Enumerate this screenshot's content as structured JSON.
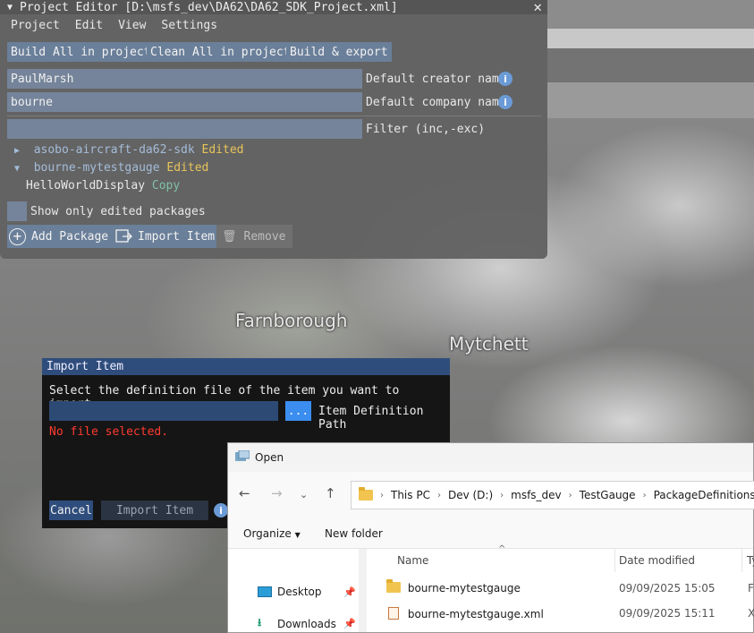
{
  "map": {
    "labels": [
      "Farnborough",
      "Mytchett"
    ]
  },
  "project_editor": {
    "title": "Project Editor [D:\\msfs_dev\\DA62\\DA62_SDK_Project.xml]",
    "menu": [
      "Project",
      "Edit",
      "View",
      "Settings"
    ],
    "buttons": {
      "build_all": "Build All in project",
      "clean_all": "Clean All in project",
      "build_export": "Build & export"
    },
    "creator": {
      "value": "PaulMarsh",
      "label": "Default creator name"
    },
    "company": {
      "value": "bourne",
      "label": "Default company name"
    },
    "filter": {
      "value": "",
      "label": "Filter (inc,-exc)"
    },
    "tree": [
      {
        "name": "asobo-aircraft-da62-sdk",
        "status": "Edited"
      },
      {
        "name": "bourne-mytestgauge",
        "status": "Edited"
      },
      {
        "name": "HelloWorldDisplay",
        "status": "Copy"
      }
    ],
    "show_edited_label": "Show only edited packages",
    "bottom_buttons": {
      "add_package": "Add Package",
      "import_item": "Import Item",
      "remove": "Remove"
    }
  },
  "import_dialog": {
    "title": "Import Item",
    "prompt": "Select the definition file of the item you want to import:",
    "path_value": "",
    "browse_label": "...",
    "path_label": "Item Definition Path",
    "error": "No file selected.",
    "cancel_label": "Cancel",
    "import_label": "Import Item"
  },
  "open_dialog": {
    "title": "Open",
    "breadcrumb": [
      "This PC",
      "Dev (D:)",
      "msfs_dev",
      "TestGauge",
      "PackageDefinitions"
    ],
    "organize_label": "Organize",
    "new_folder_label": "New folder",
    "nav_items": [
      {
        "label": "Desktop",
        "icon": "desktop-icon"
      },
      {
        "label": "Downloads",
        "icon": "download-icon"
      }
    ],
    "columns": [
      "Name",
      "Date modified",
      "Ty"
    ],
    "files": [
      {
        "name": "bourne-mytestgauge",
        "date": "09/09/2025 15:05",
        "type": "F",
        "icon": "folder-icon"
      },
      {
        "name": "bourne-mytestgauge.xml",
        "date": "09/09/2025 15:11",
        "type": "X",
        "icon": "xml-file-icon"
      }
    ]
  },
  "colors": {
    "accent_blue": "#3b8ef0",
    "edited": "#e8c45a",
    "copy": "#7fc2a6",
    "error": "#ff3b30"
  }
}
